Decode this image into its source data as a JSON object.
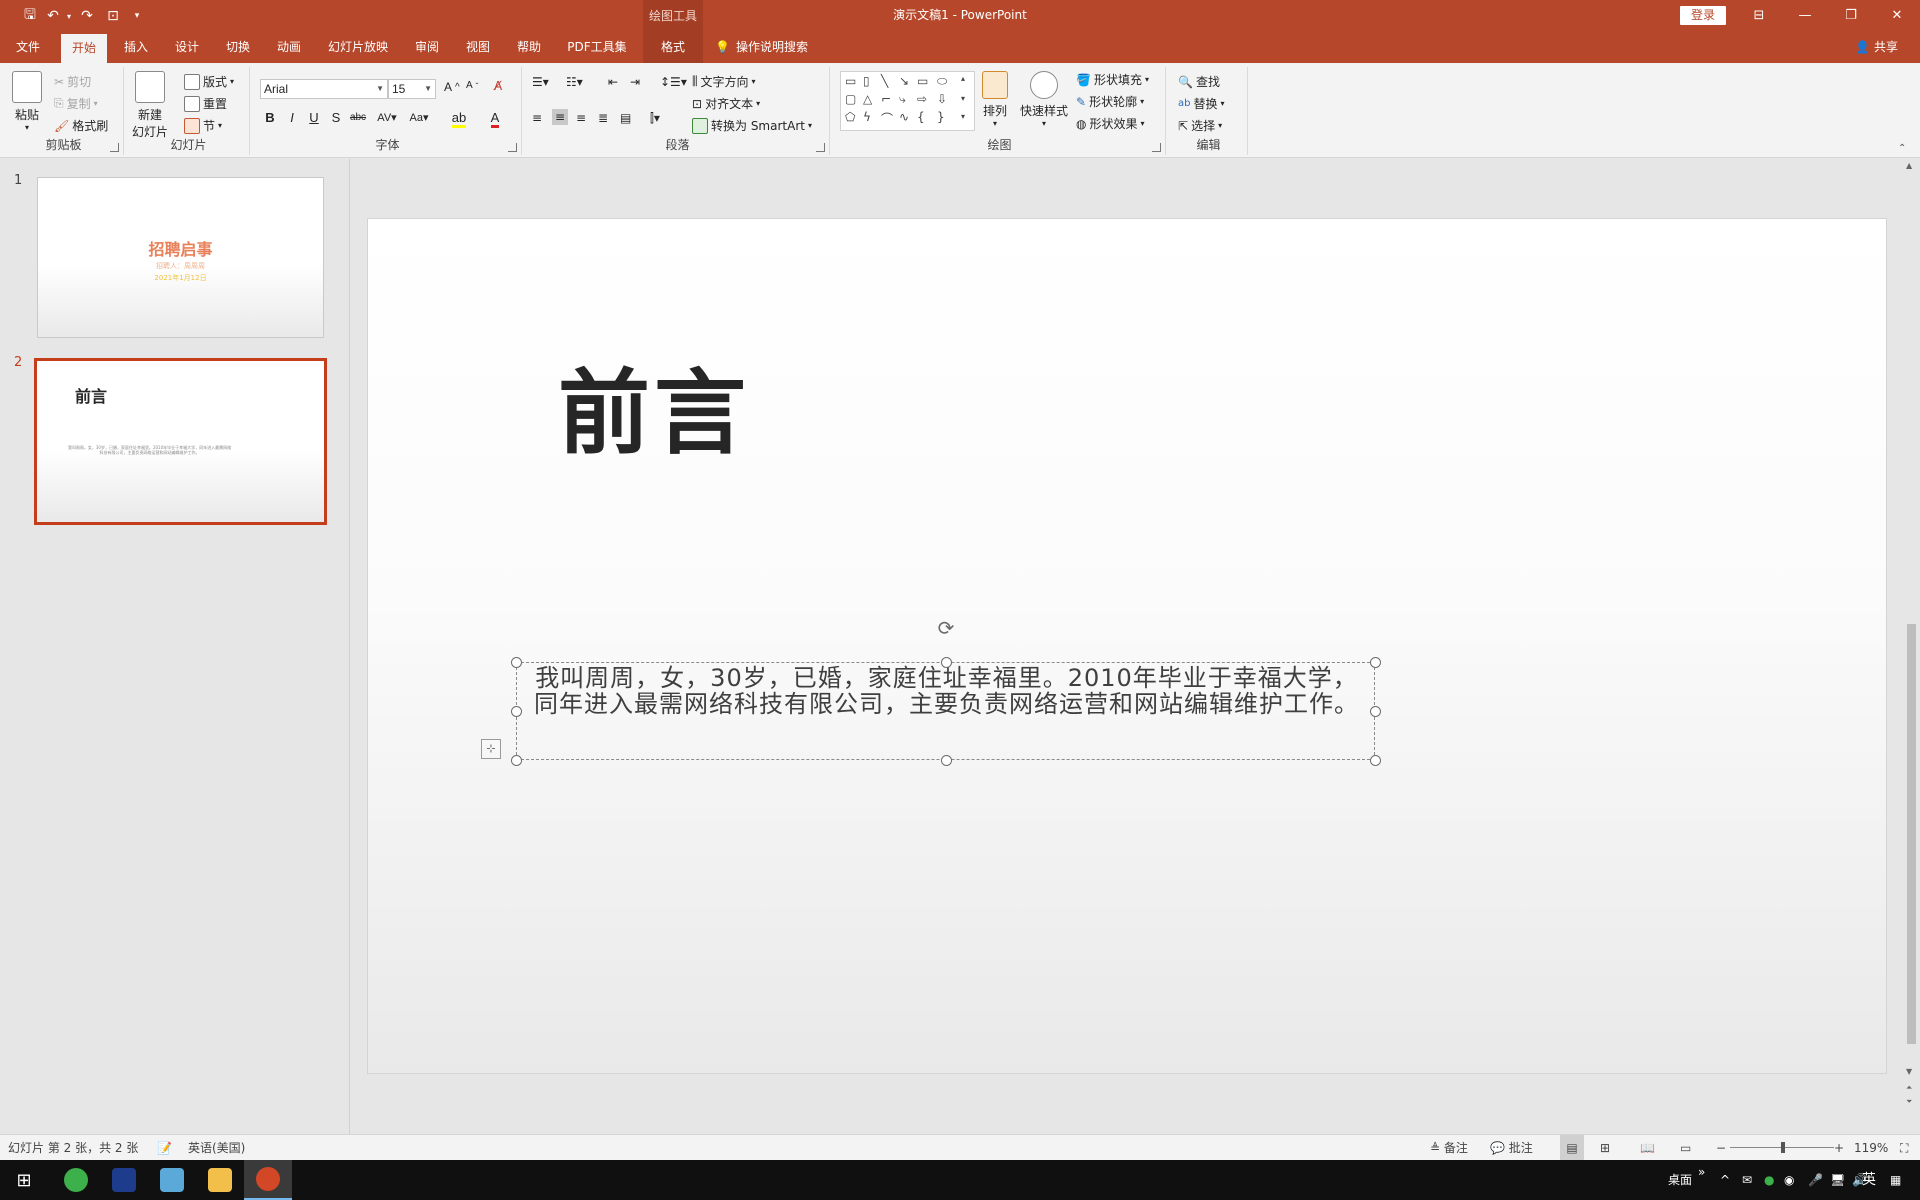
{
  "app": {
    "doc_title": "演示文稿1  -  PowerPoint",
    "context_tab_group": "绘图工具",
    "login_label": "登录",
    "share_label": "共享"
  },
  "tabs": [
    {
      "label": "文件"
    },
    {
      "label": "开始"
    },
    {
      "label": "插入"
    },
    {
      "label": "设计"
    },
    {
      "label": "切换"
    },
    {
      "label": "动画"
    },
    {
      "label": "幻灯片放映"
    },
    {
      "label": "审阅"
    },
    {
      "label": "视图"
    },
    {
      "label": "帮助"
    },
    {
      "label": "PDF工具集"
    },
    {
      "label": "格式"
    }
  ],
  "tell_me": "操作说明搜索",
  "ribbon": {
    "clipboard": {
      "label": "剪贴板",
      "paste": "粘贴",
      "cut": "剪切",
      "copy": "复制",
      "format_painter": "格式刷"
    },
    "slides": {
      "label": "幻灯片",
      "new_slide_line1": "新建",
      "new_slide_line2": "幻灯片",
      "layout": "版式",
      "reset": "重置",
      "section": "节"
    },
    "font": {
      "label": "字体",
      "font_name": "Arial",
      "font_size": "15"
    },
    "paragraph": {
      "label": "段落",
      "text_direction": "文字方向",
      "align_text": "对齐文本",
      "convert_smartart": "转换为 SmartArt"
    },
    "drawing": {
      "label": "绘图",
      "arrange": "排列",
      "quick_styles": "快速样式",
      "shape_fill": "形状填充",
      "shape_outline": "形状轮廓",
      "shape_effects": "形状效果"
    },
    "editing": {
      "label": "编辑",
      "find": "查找",
      "replace": "替换",
      "select": "选择"
    }
  },
  "thumbnails": [
    {
      "num": "1",
      "title": "招聘启事",
      "line1": "招聘人：周周周",
      "line2": "2021年1月12日"
    },
    {
      "num": "2",
      "title": "前言",
      "body": "我叫周周，女，30岁，已婚，家庭住址幸福里。2010年毕业于幸福大学，同年进入最需网络科技有限公司，主要负责网络运营和网站编辑维护工作。"
    }
  ],
  "slide": {
    "title": "前言",
    "body": "我叫周周，女，30岁，已婚，家庭住址幸福里。2010年毕业于幸福大学，同年进入最需网络科技有限公司，主要负责网络运营和网站编辑维护工作。"
  },
  "status": {
    "slide_info": "幻灯片 第 2 张，共 2 张",
    "language": "英语(美国)",
    "notes": "备注",
    "comments": "批注",
    "zoom": "119%"
  },
  "taskbar": {
    "desktop": "桌面",
    "ime": "英"
  }
}
